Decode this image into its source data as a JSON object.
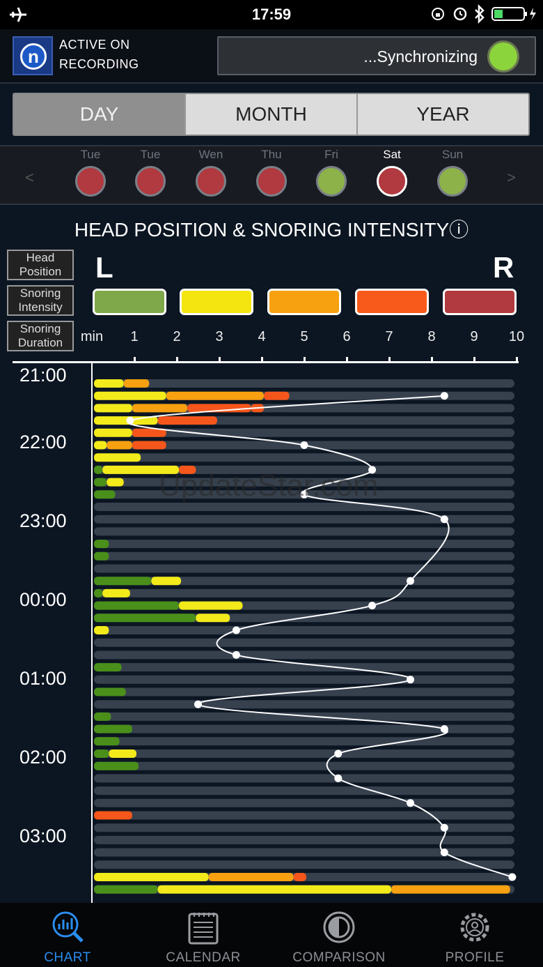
{
  "status": {
    "time": "17:59"
  },
  "header": {
    "rec_line1": "ACTIVE ON",
    "rec_line2": "RECORDING",
    "sync_label": "...Synchronizing",
    "logo_letter": "n"
  },
  "tabs": [
    "DAY",
    "MONTH",
    "YEAR"
  ],
  "days": [
    {
      "label": "Tue",
      "color": "#b03a3f"
    },
    {
      "label": "Tue",
      "color": "#b03a3f"
    },
    {
      "label": "Wen",
      "color": "#b03a3f"
    },
    {
      "label": "Thu",
      "color": "#b03a3f"
    },
    {
      "label": "Fri",
      "color": "#8db249"
    },
    {
      "label": "Sat",
      "color": "#b03a3f",
      "selected": true
    },
    {
      "label": "Sun",
      "color": "#8db249"
    }
  ],
  "nav_arrows": {
    "prev": "<",
    "next": ">"
  },
  "chart_title": "HEAD POSITION & SNORING INTENSITY",
  "info_icon": "ⓘ",
  "legend": {
    "head": "Head Position",
    "snoring": "Snoring Intensity",
    "duration": "Snoring Duration",
    "left": "L",
    "right": "R",
    "min_label": "min",
    "swatches": [
      "#7fa84a",
      "#f4e510",
      "#f7a010",
      "#f75a1b",
      "#b03a3f"
    ]
  },
  "watermark": "UpdateStar.com",
  "bottom_nav": [
    {
      "label": "CHART",
      "icon": "chart-icon",
      "active": true
    },
    {
      "label": "CALENDAR",
      "icon": "calendar-icon"
    },
    {
      "label": "COMPARISON",
      "icon": "comparison-icon"
    },
    {
      "label": "PROFILE",
      "icon": "profile-icon"
    }
  ],
  "chart_data": {
    "type": "bar",
    "x_ticks": [
      "1",
      "2",
      "3",
      "4",
      "5",
      "6",
      "7",
      "8",
      "9",
      "10"
    ],
    "x_unit": "min",
    "xlim": [
      0,
      10
    ],
    "y_ticks": [
      "21:00",
      "22:00",
      "23:00",
      "00:00",
      "01:00",
      "02:00",
      "03:00"
    ],
    "colors": {
      "G": "#4a8f1a",
      "Y": "#f2ea1a",
      "O": "#f7a010",
      "R": "#f5561b"
    },
    "rows": [
      [
        [
          "Y",
          0.7
        ],
        [
          "O",
          0.6
        ]
      ],
      [
        [
          "Y",
          1.7
        ],
        [
          "O",
          2.3
        ],
        [
          "R",
          0.6
        ]
      ],
      [
        [
          "Y",
          0.9
        ],
        [
          "O",
          1.3
        ],
        [
          "R",
          1.5
        ],
        [
          "R",
          0.3
        ]
      ],
      [
        [
          "Y",
          1.5
        ],
        [
          "R",
          1.4
        ]
      ],
      [
        [
          "Y",
          0.9
        ],
        [
          "R",
          0.8
        ]
      ],
      [
        [
          "Y",
          0.3
        ],
        [
          "O",
          0.6
        ],
        [
          "R",
          0.8
        ]
      ],
      [
        [
          "Y",
          1.1
        ]
      ],
      [
        [
          "G",
          0.2
        ],
        [
          "Y",
          1.8
        ],
        [
          "R",
          0.4
        ]
      ],
      [
        [
          "G",
          0.3
        ],
        [
          "Y",
          0.4
        ]
      ],
      [
        [
          "G",
          0.5
        ]
      ],
      [],
      [],
      [],
      [
        [
          "G",
          0.35
        ]
      ],
      [
        [
          "G",
          0.35
        ]
      ],
      [],
      [
        [
          "G",
          1.35
        ],
        [
          "Y",
          0.7
        ]
      ],
      [
        [
          "G",
          0.2
        ],
        [
          "Y",
          0.65
        ]
      ],
      [
        [
          "G",
          2.0
        ],
        [
          "Y",
          1.5
        ]
      ],
      [
        [
          "G",
          2.4
        ],
        [
          "Y",
          0.8
        ]
      ],
      [
        [
          "Y",
          0.35
        ]
      ],
      [],
      [],
      [
        [
          "G",
          0.65
        ]
      ],
      [],
      [
        [
          "G",
          0.75
        ]
      ],
      [],
      [
        [
          "G",
          0.4
        ]
      ],
      [
        [
          "G",
          0.9
        ]
      ],
      [
        [
          "G",
          0.6
        ]
      ],
      [
        [
          "G",
          0.35
        ],
        [
          "Y",
          0.65
        ]
      ],
      [
        [
          "G",
          1.05
        ]
      ],
      [],
      [],
      [],
      [
        [
          "R",
          0.9
        ]
      ],
      [],
      [],
      [],
      [],
      [
        [
          "Y",
          2.7
        ],
        [
          "O",
          2.0
        ],
        [
          "R",
          0.3
        ]
      ],
      [
        [
          "G",
          1.5
        ],
        [
          "Y",
          5.5
        ],
        [
          "O",
          2.8
        ]
      ]
    ],
    "head_position": [
      [
        8.3,
        1
      ],
      [
        0.9,
        3
      ],
      [
        5.0,
        5
      ],
      [
        6.6,
        7
      ],
      [
        5.0,
        9
      ],
      [
        8.3,
        11
      ],
      [
        7.5,
        16
      ],
      [
        6.6,
        18
      ],
      [
        3.4,
        20
      ],
      [
        3.4,
        22
      ],
      [
        7.5,
        24
      ],
      [
        2.5,
        26
      ],
      [
        8.3,
        28
      ],
      [
        5.8,
        30
      ],
      [
        5.8,
        32
      ],
      [
        7.5,
        34
      ],
      [
        8.3,
        36
      ],
      [
        8.3,
        38
      ],
      [
        9.9,
        40
      ]
    ]
  }
}
